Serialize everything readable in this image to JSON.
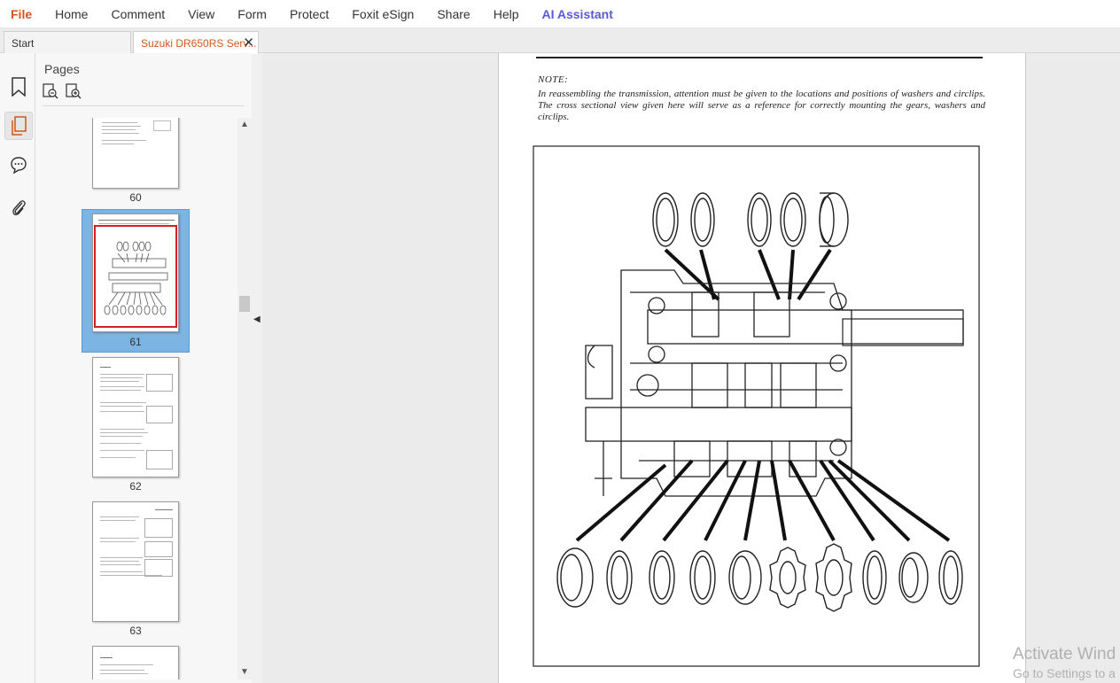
{
  "menu": {
    "file": "File",
    "home": "Home",
    "comment": "Comment",
    "view": "View",
    "form": "Form",
    "protect": "Protect",
    "esign": "Foxit eSign",
    "share": "Share",
    "help": "Help",
    "ai": "AI Assistant"
  },
  "tabs": {
    "start": "Start",
    "document": "Suzuki DR650RS Serv...",
    "close": "✕"
  },
  "pages_panel": {
    "title": "Pages",
    "thumbnails": [
      {
        "label": "60"
      },
      {
        "label": "61"
      },
      {
        "label": "62"
      },
      {
        "label": "63"
      }
    ]
  },
  "document": {
    "note_title": "NOTE:",
    "note_body": "In reassembling the transmission, attention must be given to the locations and positions of washers and circlips. The cross sectional view given here will serve as a reference for correctly mounting the gears, washers and circlips."
  },
  "watermark": {
    "line1": "Activate Wind",
    "line2": "Go to Settings to a"
  },
  "colors": {
    "accent": "#d2551c",
    "ai": "#5a5ad6",
    "selection": "#7cb4e4"
  }
}
